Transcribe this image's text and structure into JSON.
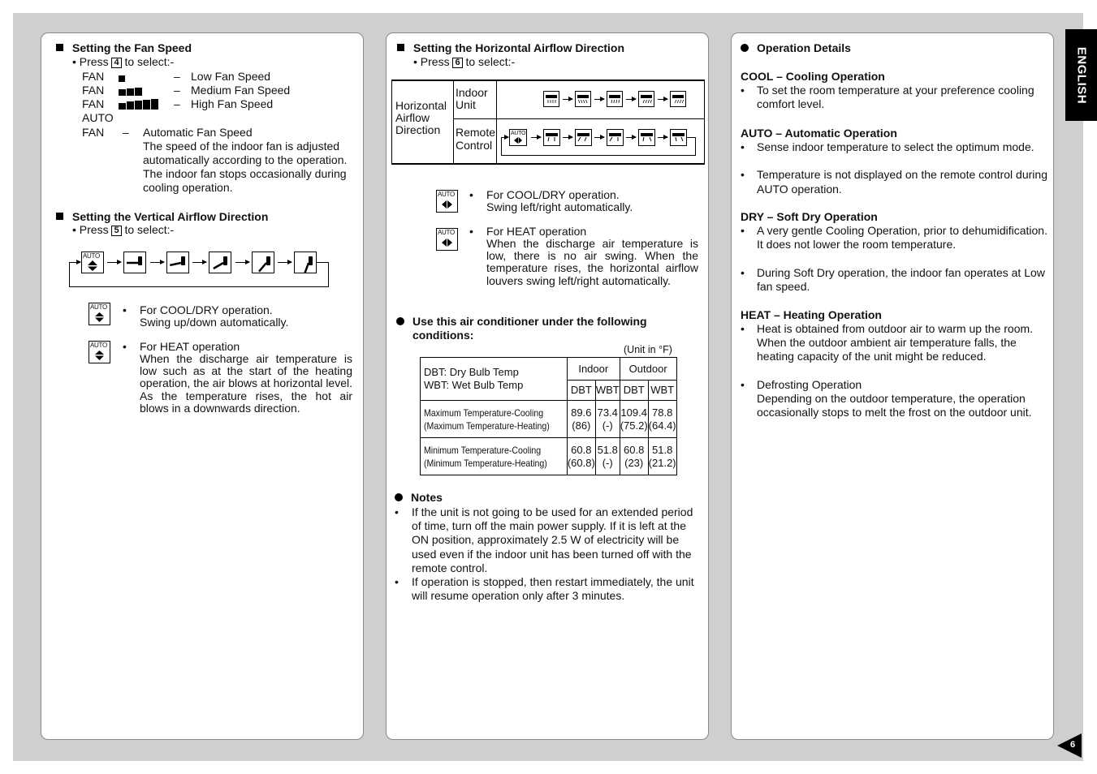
{
  "side_tab": "ENGLISH",
  "page_number": "6",
  "fan_speed": {
    "title": "Setting the Fan Speed",
    "press_pre": "• Press",
    "key": "4",
    "press_post": "to select:-",
    "rows": [
      {
        "label": "FAN",
        "bars": 1,
        "dash": "–",
        "desc": "Low Fan Speed"
      },
      {
        "label": "FAN",
        "bars": 3,
        "dash": "–",
        "desc": "Medium Fan Speed"
      },
      {
        "label": "FAN",
        "bars": 5,
        "dash": "–",
        "desc": "High Fan Speed"
      }
    ],
    "auto_label1": "AUTO",
    "auto_label2": "FAN",
    "auto_dash": "–",
    "auto_title": "Automatic Fan Speed",
    "auto_desc": [
      "The speed of the indoor fan is adjusted",
      "automatically according to the operation.",
      "The indoor fan stops occasionally during",
      "cooling operation."
    ]
  },
  "vertical": {
    "title": "Setting the Vertical Airflow Direction",
    "press_pre": "• Press",
    "key": "5",
    "press_post": "to select:-",
    "auto_label": "AUTO",
    "notes": [
      {
        "icon_label": "AUTO",
        "bullet": "•",
        "title": "For COOL/DRY operation.",
        "text": "Swing up/down automatically."
      },
      {
        "icon_label": "AUTO",
        "bullet": "•",
        "title": "For HEAT operation",
        "text": "When the discharge air temperature is low such as at the start of the heating operation, the air blows at horizontal level. As the temperature rises, the hot air blows in a downwards direction."
      }
    ]
  },
  "horizontal": {
    "title": "Setting the Horizontal Airflow Direction",
    "press_pre": "• Press",
    "key": "6",
    "press_post": "to select:-",
    "row_header": [
      "Horizontal",
      "Airflow",
      "Direction"
    ],
    "indoor_label": [
      "Indoor",
      "Unit"
    ],
    "remote_label": [
      "Remote",
      "Control"
    ],
    "auto_label": "AUTO",
    "notes": [
      {
        "icon_label": "AUTO",
        "bullet": "•",
        "title": "For COOL/DRY operation.",
        "text": "Swing left/right automatically."
      },
      {
        "icon_label": "AUTO",
        "bullet": "•",
        "title": "For HEAT operation",
        "text": "When the discharge air temperature is low, there is no air swing. When the temperature rises, the horizontal airflow louvers swing left/right automatically."
      }
    ]
  },
  "conditions": {
    "title_line1": "Use this air conditioner under the following",
    "title_line2": "conditions:",
    "unit": "(Unit in °F)",
    "legend": [
      "DBT: Dry Bulb Temp",
      "WBT: Wet Bulb Temp"
    ],
    "group_headers": [
      "Indoor",
      "Outdoor"
    ],
    "sub_headers": [
      "DBT",
      "WBT",
      "DBT",
      "WBT"
    ],
    "rows": [
      {
        "label": [
          "Maximum Temperature-Cooling",
          "(Maximum Temperature-Heating)"
        ],
        "values": [
          [
            "89.6",
            "(86)"
          ],
          [
            "73.4",
            "(-)"
          ],
          [
            "109.4",
            "(75.2)"
          ],
          [
            "78.8",
            "(64.4)"
          ]
        ]
      },
      {
        "label": [
          "Minimum Temperature-Cooling",
          "(Minimum Temperature-Heating)"
        ],
        "values": [
          [
            "60.8",
            "(60.8)"
          ],
          [
            "51.8",
            "(-)"
          ],
          [
            "60.8",
            "(23)"
          ],
          [
            "51.8",
            "(21.2)"
          ]
        ]
      }
    ]
  },
  "notes": {
    "title": "Notes",
    "items": [
      "If the unit is not going to be used for an extended period of time, turn off the main power supply. If it is left at the ON position, approximately 2.5 W of electricity will be used even if the indoor unit has been turned off with the remote control.",
      "If operation is stopped, then restart immediately, the unit will resume operation only after 3 minutes."
    ]
  },
  "operation": {
    "title": "Operation Details",
    "sections": [
      {
        "heading": "COOL – Cooling Operation",
        "items": [
          "To set the room temperature at your preference cooling comfort level."
        ]
      },
      {
        "heading": "AUTO – Automatic Operation",
        "items": [
          "Sense indoor temperature to select the optimum mode.",
          "Temperature is not displayed on the remote control during AUTO operation."
        ]
      },
      {
        "heading": "DRY – Soft Dry Operation",
        "items": [
          "A very gentle Cooling Operation, prior to dehumidification. It does not lower the room temperature.",
          "During Soft Dry operation, the indoor fan operates at Low fan speed."
        ]
      },
      {
        "heading": "HEAT – Heating Operation",
        "items": [
          "Heat is obtained from outdoor air to warm up the room. When the outdoor ambient air temperature falls, the heating capacity of the unit might be reduced.",
          "Defrosting Operation\nDepending on the outdoor temperature, the operation occasionally stops to melt the frost on the outdoor unit."
        ]
      }
    ]
  }
}
